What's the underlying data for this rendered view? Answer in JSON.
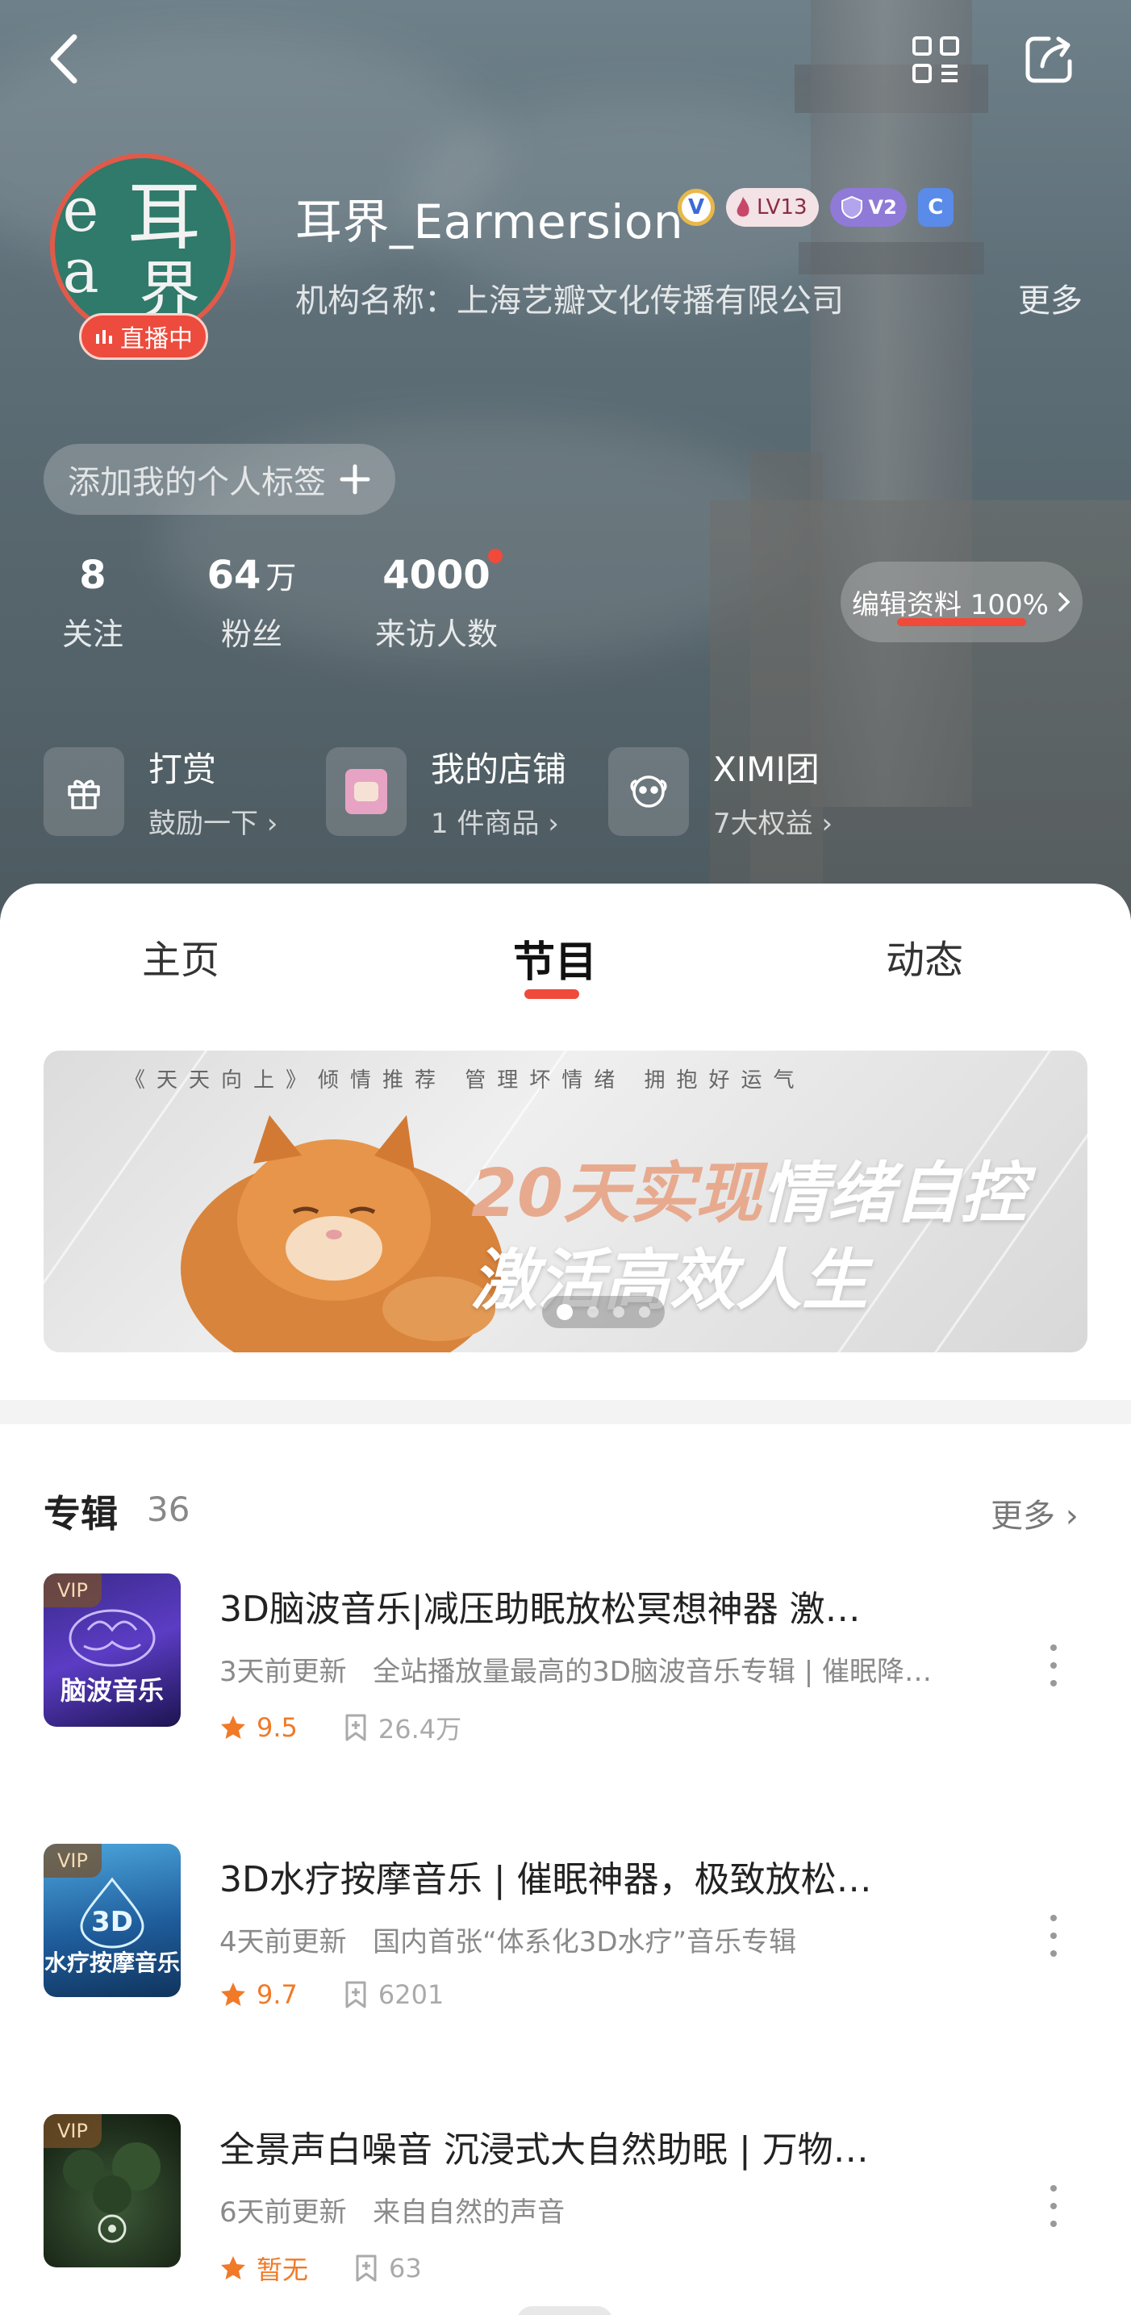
{
  "header": {
    "back_icon": "chevron-left-icon",
    "qr_icon": "qr-code-icon",
    "share_icon": "share-icon"
  },
  "profile": {
    "live_badge": "直播中",
    "username": "耳界_Earmersion",
    "level": "LV13",
    "vip": "V2",
    "c_badge": "C",
    "org": "机构名称：上海艺瓣文化传播有限公司",
    "more": "更多",
    "tag_pill": "添加我的个人标签",
    "stats": {
      "follow_num": "8",
      "follow_label": "关注",
      "fans_num": "64",
      "fans_unit": "万",
      "fans_label": "粉丝",
      "visit_num": "4000",
      "visit_label": "来访人数"
    },
    "edit_profile": "编辑资料 100%"
  },
  "quick_links": [
    {
      "title": "打赏",
      "sub": "鼓励一下"
    },
    {
      "title": "我的店铺",
      "sub": "1 件商品"
    },
    {
      "title": "XIMI团",
      "sub": "7大权益"
    }
  ],
  "tabs": [
    "主页",
    "节目",
    "动态"
  ],
  "active_tab": "节目",
  "banner": {
    "top_line": "《天天向上》倾情推荐 管理坏情绪 拥抱好运气",
    "line1_a": "20天实现",
    "line1_b": "情绪自控",
    "line2": "激活高效人生",
    "pages": 4,
    "current_page": 1
  },
  "albums_section": {
    "title": "专辑",
    "count": "36",
    "more": "更多"
  },
  "albums": [
    {
      "vip": "VIP",
      "cover_text": "脑波音乐",
      "title": "3D脑波音乐|减压助眠放松冥想神器 激…",
      "updated": "3天前更新",
      "desc": "全站播放量最高的3D脑波音乐专辑 | 催眠降…",
      "score": "9.5",
      "plays": "26.4万"
    },
    {
      "vip": "VIP",
      "cover_text": "水疗按摩音乐",
      "title": "3D水疗按摩音乐 | 催眠神器，极致放松…",
      "updated": "4天前更新",
      "desc": "国内首张“体系化3D水疗”音乐专辑",
      "score": "9.7",
      "plays": "6201"
    },
    {
      "vip": "VIP",
      "cover_text": "",
      "title": "全景声白噪音 沉浸式大自然助眠 | 万物…",
      "updated": "6天前更新",
      "desc": "来自自然的声音",
      "score": "暂无",
      "plays": "63"
    }
  ],
  "colors": {
    "accent_red": "#f04a3a",
    "score_orange": "#f07a28"
  }
}
